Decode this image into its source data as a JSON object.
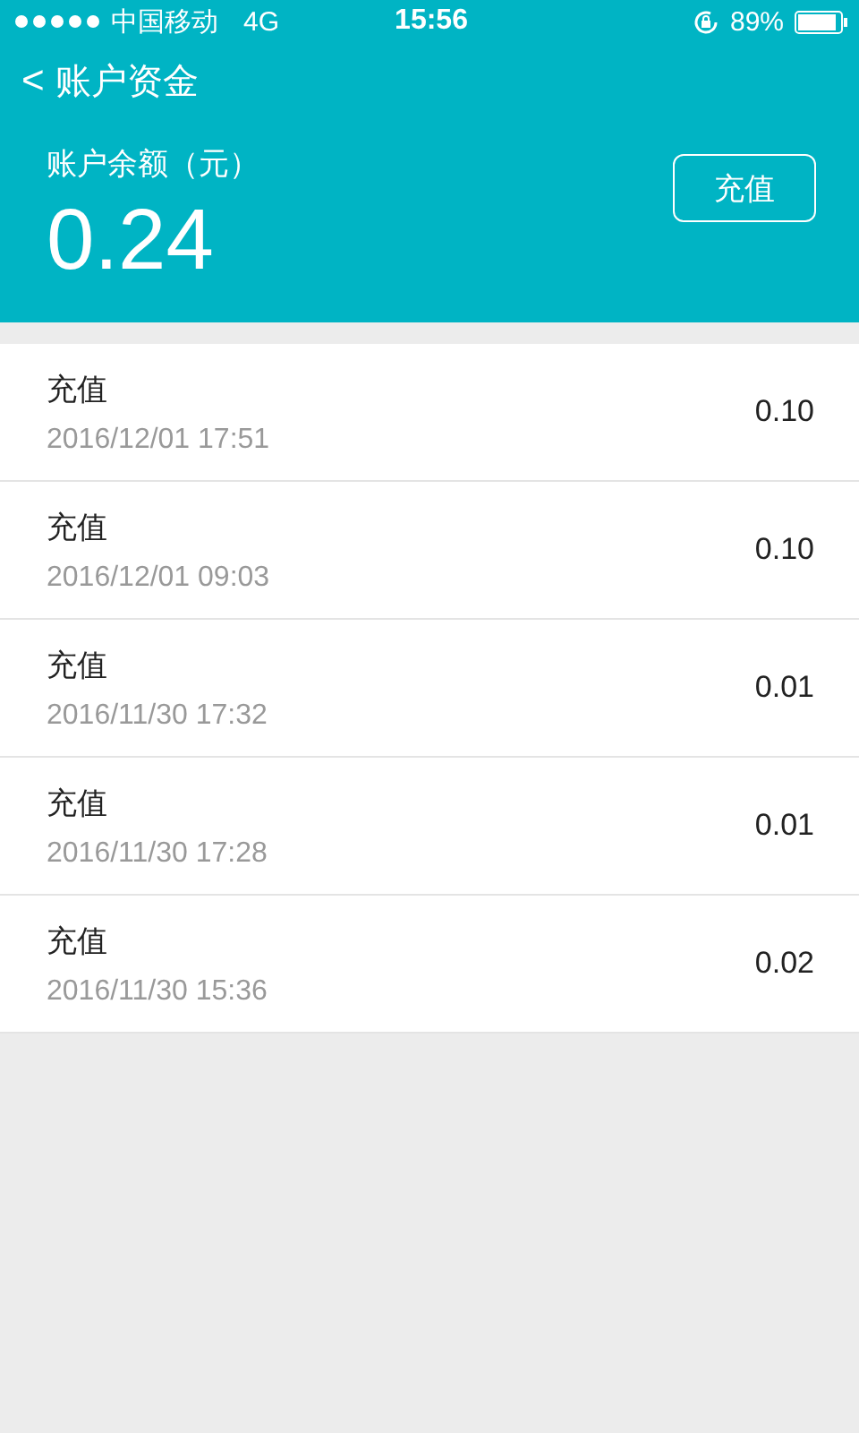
{
  "status_bar": {
    "carrier": "中国移动",
    "network": "4G",
    "time": "15:56",
    "battery": "89%"
  },
  "nav": {
    "back": "<",
    "title": "账户资金"
  },
  "balance": {
    "label": "账户余额（元）",
    "amount": "0.24",
    "button": "充值"
  },
  "records": [
    {
      "title": "充值",
      "time": "2016/12/01 17:51",
      "amount": "0.10"
    },
    {
      "title": "充值",
      "time": "2016/12/01 09:03",
      "amount": "0.10"
    },
    {
      "title": "充值",
      "time": "2016/11/30 17:32",
      "amount": "0.01"
    },
    {
      "title": "充值",
      "time": "2016/11/30 17:28",
      "amount": "0.01"
    },
    {
      "title": "充值",
      "time": "2016/11/30 15:36",
      "amount": "0.02"
    }
  ]
}
